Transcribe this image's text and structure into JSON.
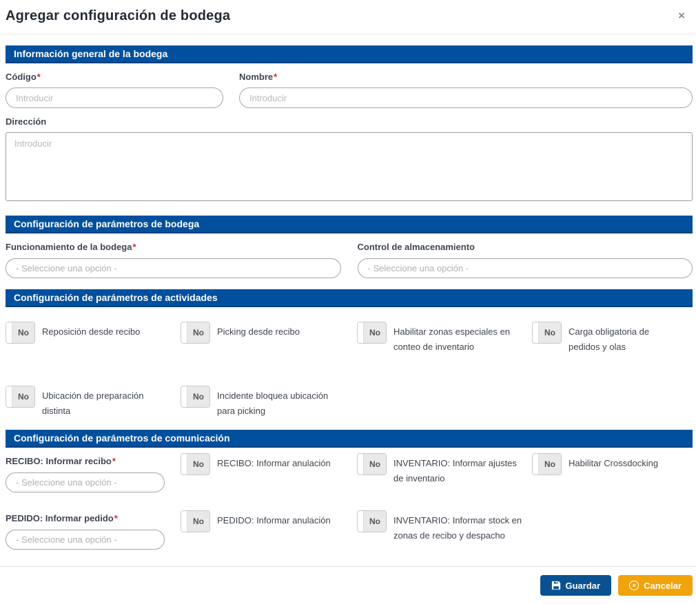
{
  "modal": {
    "title": "Agregar configuración de bodega",
    "close_icon": "×"
  },
  "general": {
    "header": "Información general de la bodega",
    "codigo": {
      "label": "Código",
      "required": "*",
      "placeholder": "Introducir"
    },
    "nombre": {
      "label": "Nombre",
      "required": "*",
      "placeholder": "Introducir"
    },
    "direccion": {
      "label": "Dirección",
      "placeholder": "Introducir"
    }
  },
  "parametros_bodega": {
    "header": "Configuración de parámetros de bodega",
    "funcionamiento": {
      "label": "Funcionamiento de la bodega",
      "required": "*",
      "value": "- Seleccione una opción -"
    },
    "control": {
      "label": "Control de almacenamiento",
      "value": "- Seleccione una opción -"
    }
  },
  "parametros_actividades": {
    "header": "Configuración de parámetros de actividades",
    "toggles": [
      {
        "state": "No",
        "label": "Reposición desde recibo"
      },
      {
        "state": "No",
        "label": "Picking desde recibo"
      },
      {
        "state": "No",
        "label": "Habilitar zonas especiales en conteo de inventario"
      },
      {
        "state": "No",
        "label": "Carga obligatoria de pedidos y olas"
      },
      {
        "state": "No",
        "label": "Ubicación de preparación distinta"
      },
      {
        "state": "No",
        "label": "Incidente bloquea ubicación para picking"
      }
    ]
  },
  "parametros_comunicacion": {
    "header": "Configuración de parámetros de comunicación",
    "recibo": {
      "label": "RECIBO: Informar recibo",
      "required": "*",
      "value": "- Seleccione una opción -"
    },
    "pedido": {
      "label": "PEDIDO: Informar pedido",
      "required": "*",
      "value": "- Seleccione una opción -"
    },
    "toggles": [
      {
        "state": "No",
        "label": "RECIBO: Informar anulación"
      },
      {
        "state": "No",
        "label": "INVENTARIO: Informar ajustes de inventario"
      },
      {
        "state": "No",
        "label": "Habilitar Crossdocking"
      },
      {
        "state": "No",
        "label": "PEDIDO: Informar anulación"
      },
      {
        "state": "No",
        "label": "INVENTARIO: Informar stock en zonas de recibo y despacho"
      }
    ]
  },
  "footer": {
    "save_label": "Guardar",
    "cancel_label": "Cancelar",
    "save_color": "#0a5191",
    "cancel_color": "#f0a30b",
    "section_header_color": "#00509e"
  }
}
